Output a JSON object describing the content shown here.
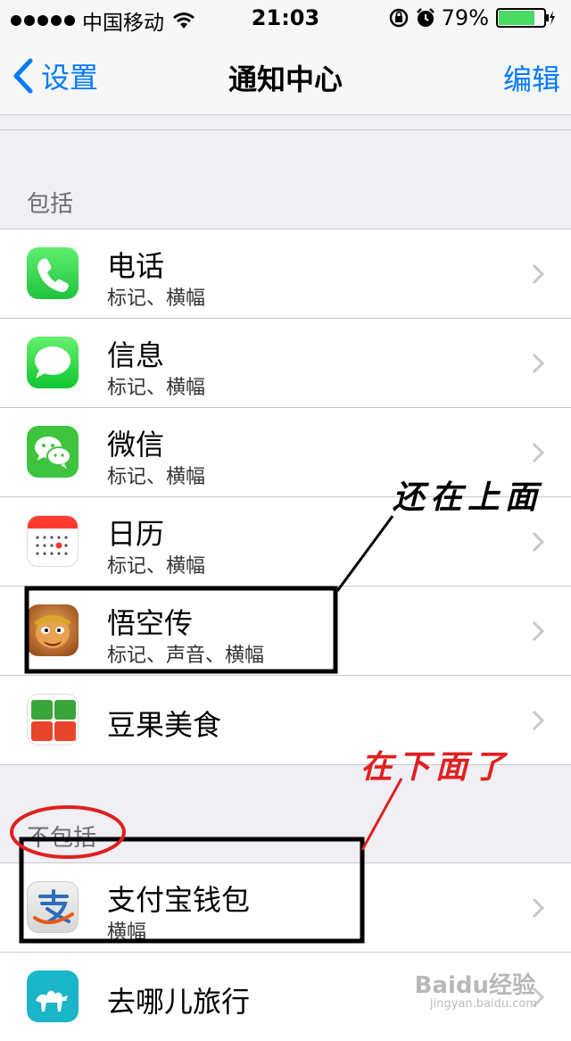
{
  "status_bar": {
    "carrier": "中国移动",
    "time": "21:03",
    "battery": "79%",
    "battery_level": 0.79
  },
  "nav": {
    "back_label": "设置",
    "title": "通知中心",
    "edit_label": "编辑"
  },
  "sections": {
    "included_header": "包括",
    "excluded_header": "不包括"
  },
  "included": [
    {
      "title": "电话",
      "subtitle": "标记、横幅",
      "icon": "phone-icon",
      "color": "#3fd75a"
    },
    {
      "title": "信息",
      "subtitle": "标记、横幅",
      "icon": "messages-icon",
      "color": "#3fd75a"
    },
    {
      "title": "微信",
      "subtitle": "标记、横幅",
      "icon": "wechat-icon",
      "color": "#3ec43e"
    },
    {
      "title": "日历",
      "subtitle": "标记、横幅",
      "icon": "calendar-icon",
      "color": "#ffffff"
    },
    {
      "title": "悟空传",
      "subtitle": "标记、声音、横幅",
      "icon": "wukong-game-icon",
      "color": "#c77a2a"
    },
    {
      "title": "豆果美食",
      "subtitle": "",
      "icon": "douguo-icon",
      "color": "#ffffff"
    }
  ],
  "excluded": [
    {
      "title": "支付宝钱包",
      "subtitle": "横幅",
      "icon": "alipay-icon",
      "color": "#ffffff"
    },
    {
      "title": "去哪儿旅行",
      "subtitle": "",
      "icon": "qunar-icon",
      "color": "#1bb5c9"
    }
  ],
  "annotations": {
    "still_above": "还在上面",
    "now_below": "在下面了"
  },
  "watermark": {
    "brand": "Baidu经验",
    "url": "jingyan.baidu.com"
  },
  "colors": {
    "accent": "#007aff",
    "annotation_black": "#000000",
    "annotation_red": "#e02020"
  }
}
